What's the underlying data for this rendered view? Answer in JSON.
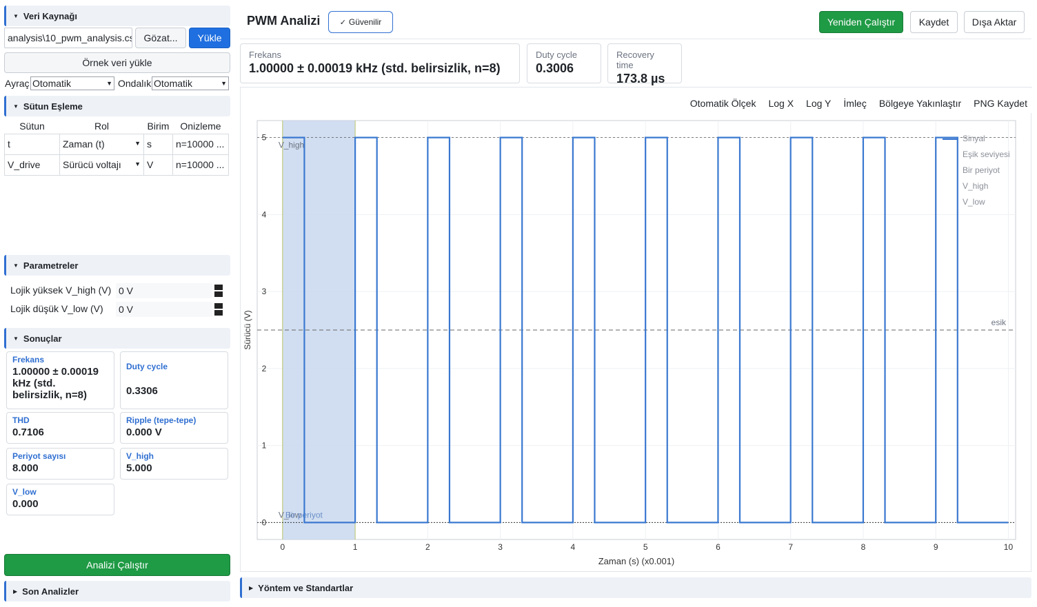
{
  "sidebar": {
    "data_source": {
      "title": "Veri Kaynağı",
      "file_path": "analysis\\10_pwm_analysis.csv",
      "browse": "Gözat...",
      "load": "Yükle",
      "sample": "Örnek veri yükle",
      "delimiter_label": "Ayraç",
      "delimiter_value": "Otomatik",
      "decimal_label": "Ondalık",
      "decimal_value": "Otomatik"
    },
    "column_mapping": {
      "title": "Sütun Eşleme",
      "headers": [
        "Sütun",
        "Rol",
        "Birim",
        "Onizleme"
      ],
      "rows": [
        {
          "col": "t",
          "role": "Zaman (t)",
          "unit": "s",
          "preview": "n=10000 ..."
        },
        {
          "col": "V_drive",
          "role": "Sürücü voltajı",
          "unit": "V",
          "preview": "n=10000 ..."
        }
      ]
    },
    "parameters": {
      "title": "Parametreler",
      "vhigh_label": "Lojik yüksek V_high (V)",
      "vhigh_value": "0 V",
      "vlow_label": "Lojik düşük V_low (V)",
      "vlow_value": "0 V"
    },
    "results": {
      "title": "Sonuçlar",
      "cards": [
        {
          "k": "Frekans",
          "v": "1.00000 ± 0.00019 kHz (std. belirsizlik, n=8)"
        },
        {
          "k": "Duty cycle",
          "v": "0.3306"
        },
        {
          "k": "THD",
          "v": "0.7106"
        },
        {
          "k": "Ripple (tepe-tepe)",
          "v": "0.000 V"
        },
        {
          "k": "Periyot sayısı",
          "v": "8.000"
        },
        {
          "k": "V_high",
          "v": "5.000"
        },
        {
          "k": "V_low",
          "v": "0.000"
        }
      ]
    },
    "run": "Analizi Çalıştır",
    "recent": "Son Analizler"
  },
  "header": {
    "title": "PWM Analizi",
    "badge": "Güvenilir",
    "rerun": "Yeniden Çalıştır",
    "save": "Kaydet",
    "export": "Dışa Aktar"
  },
  "stats": [
    {
      "k": "Frekans",
      "v": "1.00000 ± 0.00019 kHz (std. belirsizlik, n=8)"
    },
    {
      "k": "Duty cycle",
      "v": "0.3006"
    },
    {
      "k": "Recovery time",
      "v": "173.8 µs"
    }
  ],
  "plot_tools": [
    "Otomatik Ölçek",
    "Log X",
    "Log Y",
    "İmleç",
    "Bölgeye Yakınlaştır",
    "PNG Kaydet"
  ],
  "footer": {
    "methods": "Yöntem ve Standartlar"
  },
  "colors": {
    "accent": "#2f6fd1",
    "signal": "#3a78d0",
    "highlight": "#c9d8ef",
    "run": "#1f9a45"
  },
  "chart_data": {
    "type": "line",
    "xlabel": "Zaman (s) (x0.001)",
    "ylabel": "Sürücü (V)",
    "xlim": [
      -0.35,
      10.1
    ],
    "ylim": [
      -0.22,
      5.22
    ],
    "xticks": [
      0,
      1,
      2,
      3,
      4,
      5,
      6,
      7,
      8,
      9,
      10
    ],
    "yticks": [
      0,
      1,
      2,
      3,
      4,
      5
    ],
    "legend": [
      "Sinyal",
      "Eşik seviyesi",
      "Bir periyot",
      "V_high",
      "V_low"
    ],
    "legend_position": "top-right",
    "series": [
      {
        "name": "Sinyal",
        "period": 1.0,
        "high": 5,
        "low": 0,
        "pulse_width": 0.3,
        "start": 0,
        "end": 10
      }
    ],
    "threshold": {
      "value": 2.5,
      "label": "esik"
    },
    "vhigh_line": {
      "value": 5,
      "label": "V_high"
    },
    "vlow_line": {
      "value": 0,
      "label": "V_low"
    },
    "period_span": {
      "from": 0,
      "to": 1,
      "label": "Bir periyot"
    }
  }
}
